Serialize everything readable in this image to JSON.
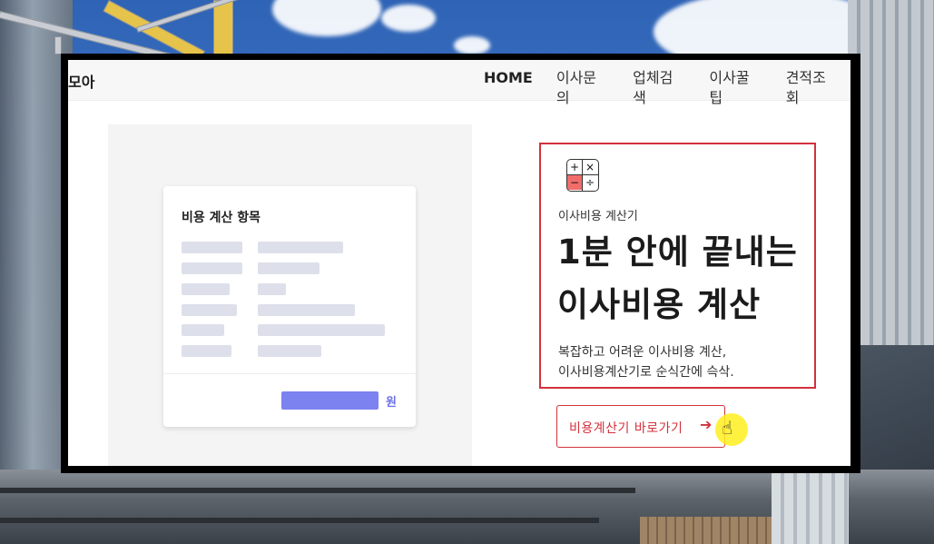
{
  "site": {
    "brand": "모아"
  },
  "nav": {
    "items": [
      "HOME",
      "이사문의",
      "업체검색",
      "이사꿀팁",
      "견적조회"
    ]
  },
  "card": {
    "title": "비용 계산 항목",
    "currency": "원"
  },
  "hero": {
    "calc_icon": {
      "plus": "+",
      "times": "×",
      "minus": "−",
      "divide": "÷"
    },
    "eyebrow": "이사비용 계산기",
    "headline_line1": "1분 안에 끝내는",
    "headline_line2": "이사비용 계산",
    "desc_line1": "복잡하고 어려운 이사비용 계산,",
    "desc_line2": "이사비용계산기로 순식간에 슥삭."
  },
  "cta": {
    "label": "비용계산기 바로가기",
    "arrow": "➔"
  },
  "colors": {
    "accent": "#d3313c",
    "card_bar": "#dde0ea",
    "total_bar": "#7c82f0"
  }
}
